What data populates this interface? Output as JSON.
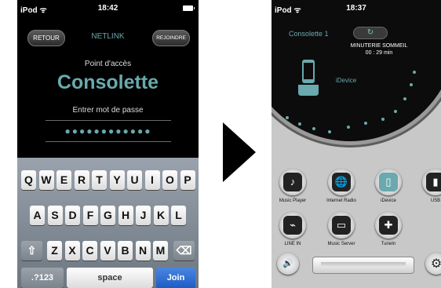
{
  "left": {
    "status": {
      "carrier": "iPod ᯤ",
      "time": "18:42"
    },
    "nav": {
      "back": "RETOUR",
      "title": "NETLINK",
      "join": "REJOINDRE"
    },
    "access_point_label": "Point d'accès",
    "ssid": "Consolette",
    "password_label": "Entrer mot de passe",
    "password_masked": "●●●●●●●●●●●●",
    "keyboard": {
      "row1": [
        "Q",
        "W",
        "E",
        "R",
        "T",
        "Y",
        "U",
        "I",
        "O",
        "P"
      ],
      "row2": [
        "A",
        "S",
        "D",
        "F",
        "G",
        "H",
        "J",
        "K",
        "L"
      ],
      "row3": [
        "Z",
        "X",
        "C",
        "V",
        "B",
        "N",
        "M"
      ],
      "shift": "⇧",
      "delete": "⌫",
      "numbers": ".?123",
      "space": "space",
      "join": "Join"
    }
  },
  "right": {
    "status": {
      "carrier": "iPod ᯤ",
      "time": "18:37"
    },
    "zone": "Consolette 1",
    "sleep_icon": "↻",
    "sleep_label": "MINUTERIE SOMMEIL",
    "sleep_value": "00 : 29 min",
    "current_source": "iDevice",
    "sources": [
      {
        "label": "Music Player",
        "icon": "music-player-icon",
        "glyph": "♪"
      },
      {
        "label": "Internet Radio",
        "icon": "internet-radio-icon",
        "glyph": "🌐"
      },
      {
        "label": "iDevice",
        "icon": "idevice-icon",
        "glyph": "▯"
      },
      {
        "label": "USB",
        "icon": "usb-icon",
        "glyph": "▮"
      },
      {
        "label": "LINE IN",
        "icon": "line-in-icon",
        "glyph": "⌁"
      },
      {
        "label": "Music Server",
        "icon": "music-server-icon",
        "glyph": "▭"
      },
      {
        "label": "TuneIn",
        "icon": "tunein-icon",
        "glyph": "✚"
      }
    ],
    "volume_icon": "🔊",
    "settings_icon": "⚙"
  },
  "colors": {
    "accent": "#6aa9ad",
    "join": "#1d5cc7"
  }
}
